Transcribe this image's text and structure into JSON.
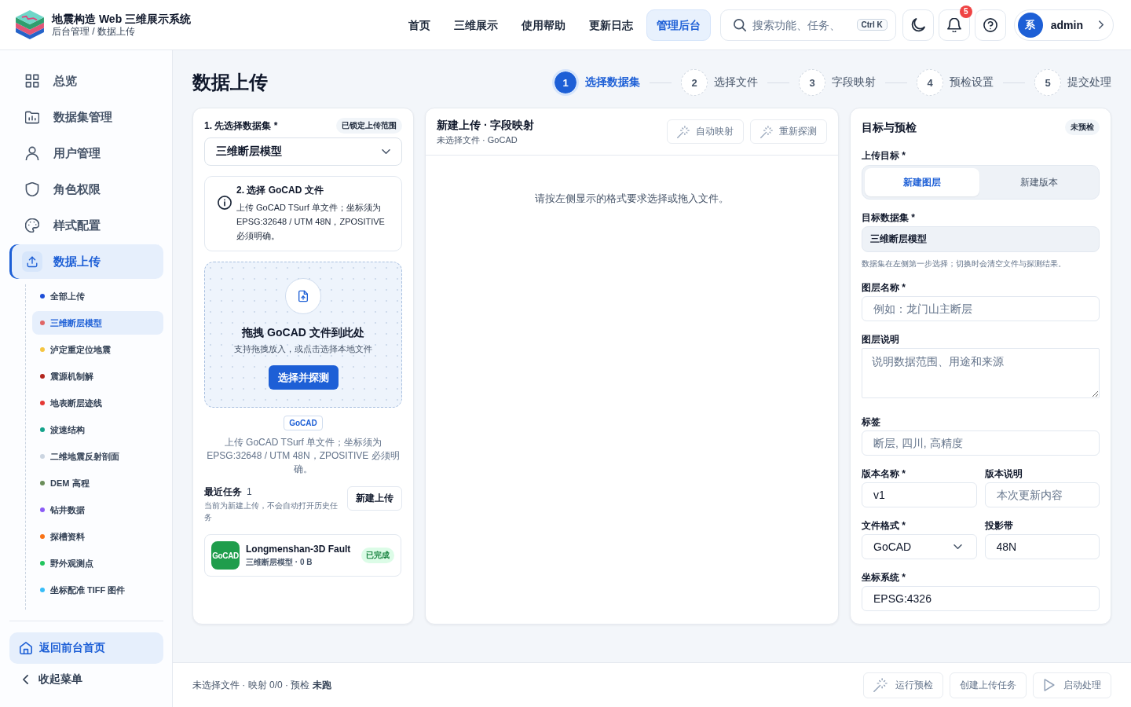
{
  "header": {
    "title": "地震构造 Web 三维展示系统",
    "breadcrumb": "后台管理 / 数据上传",
    "nav": [
      {
        "label": "首页",
        "selected": false
      },
      {
        "label": "三维展示",
        "selected": false
      },
      {
        "label": "使用帮助",
        "selected": false
      },
      {
        "label": "更新日志",
        "selected": false
      },
      {
        "label": "管理后台",
        "selected": true
      }
    ],
    "search": {
      "placeholder": "搜索功能、任务、",
      "shortcut": "Ctrl K"
    },
    "notification_count": "5",
    "user": {
      "avatar": "系",
      "name": "admin"
    }
  },
  "sidebar": {
    "items": [
      {
        "label": "总览",
        "selected": false
      },
      {
        "label": "数据集管理",
        "selected": false
      },
      {
        "label": "用户管理",
        "selected": false
      },
      {
        "label": "角色权限",
        "selected": false
      },
      {
        "label": "样式配置",
        "selected": false
      },
      {
        "label": "数据上传",
        "selected": true,
        "children": [
          {
            "label": "全部上传",
            "selected": false,
            "color": "#1d4ed8"
          },
          {
            "label": "三维断层模型",
            "selected": true,
            "color": "#e06666"
          },
          {
            "label": "泸定重定位地震",
            "selected": false,
            "color": "#f5c542"
          },
          {
            "label": "震源机制解",
            "selected": false,
            "color": "#b3261e"
          },
          {
            "label": "地表断层迹线",
            "selected": false,
            "color": "#e53935"
          },
          {
            "label": "波速结构",
            "selected": false,
            "color": "#14a38b"
          },
          {
            "label": "二维地震反射剖面",
            "selected": false,
            "color": "#cbd5e1"
          },
          {
            "label": "DEM 高程",
            "selected": false,
            "color": "#6b8e5a"
          },
          {
            "label": "钻井数据",
            "selected": false,
            "color": "#8b5cf6"
          },
          {
            "label": "探槽资料",
            "selected": false,
            "color": "#f97316"
          },
          {
            "label": "野外观测点",
            "selected": false,
            "color": "#22c55e"
          },
          {
            "label": "坐标配准 TIFF 图件",
            "selected": false,
            "color": "#38bdf8"
          }
        ]
      }
    ],
    "home_button": "返回前台首页",
    "collapse_button": "收起菜单"
  },
  "page": {
    "title": "数据上传",
    "steps": [
      {
        "number": "1",
        "label": "选择数据集",
        "selected": true
      },
      {
        "number": "2",
        "label": "选择文件",
        "selected": false
      },
      {
        "number": "3",
        "label": "字段映射",
        "selected": false
      },
      {
        "number": "4",
        "label": "预检设置",
        "selected": false
      },
      {
        "number": "5",
        "label": "提交处理",
        "selected": false
      }
    ]
  },
  "dataset_card": {
    "label": "1. 先选择数据集 *",
    "badge": "已锁定上传范围",
    "select": "三维断层模型",
    "info": {
      "title": "2. 选择 GoCAD 文件",
      "text": "上传 GoCAD TSurf 单文件；坐标须为 EPSG:32648 / UTM 48N，ZPOSITIVE 必须明确。"
    },
    "dropzone": {
      "title": "拖拽 GoCAD 文件到此处",
      "hint": "支持拖拽放入，或点击选择本地文件",
      "button": "选择并探测"
    },
    "format_tag": "GoCAD",
    "format_note": "上传 GoCAD TSurf 单文件；坐标须为 EPSG:32648 / UTM 48N，ZPOSITIVE 必须明确。",
    "recent": {
      "title": "最近任务",
      "count": "1",
      "note": "当前为新建上传，不会自动打开历史任务",
      "button": "新建上传",
      "tasks": [
        {
          "badge": "GoCAD",
          "name": "Longmenshan-3D Fault",
          "meta": "三维断层模型 · 0 B",
          "status": "已完成"
        }
      ]
    }
  },
  "mapping_card": {
    "title": "新建上传 · 字段映射",
    "subtitle": "未选择文件 · GoCAD",
    "buttons": [
      {
        "label": "自动映射",
        "disabled": true
      },
      {
        "label": "重新探测",
        "disabled": true
      }
    ],
    "empty_message": "请按左侧显示的格式要求选择或拖入文件。"
  },
  "target_card": {
    "title": "目标与预检",
    "badge": "未预检",
    "target": {
      "label": "上传目标 *",
      "options": [
        {
          "label": "新建图层",
          "selected": true
        },
        {
          "label": "新建版本",
          "selected": false
        }
      ]
    },
    "rows": [
      [
        {
          "kind": "readonly",
          "label": "目标数据集 *",
          "value": "三维断层模型",
          "hint": "数据集在左侧第一步选择；切换时会清空文件与探测结果。"
        }
      ],
      [
        {
          "kind": "input",
          "label": "图层名称 *",
          "placeholder": "例如：龙门山主断层"
        }
      ],
      [
        {
          "kind": "textarea",
          "label": "图层说明",
          "placeholder": "说明数据范围、用途和来源"
        }
      ],
      [
        {
          "kind": "input",
          "label": "标签",
          "placeholder": "断层, 四川, 高精度"
        }
      ],
      [
        {
          "kind": "input",
          "label": "版本名称 *",
          "value": "v1"
        },
        {
          "kind": "input",
          "label": "版本说明",
          "placeholder": "本次更新内容"
        }
      ],
      [
        {
          "kind": "select",
          "label": "文件格式 *",
          "value": "GoCAD"
        },
        {
          "kind": "input",
          "label": "投影带",
          "value": "48N"
        }
      ],
      [
        {
          "kind": "input",
          "label": "坐标系统 *",
          "value": "EPSG:4326"
        }
      ]
    ]
  },
  "footer": {
    "status": "未选择文件 · 映射 0/0 · 预检 **未跑**",
    "buttons": [
      {
        "label": "运行预检",
        "disabled": true
      },
      {
        "label": "创建上传任务",
        "disabled": true
      },
      {
        "label": "启动处理",
        "disabled": true
      }
    ]
  }
}
